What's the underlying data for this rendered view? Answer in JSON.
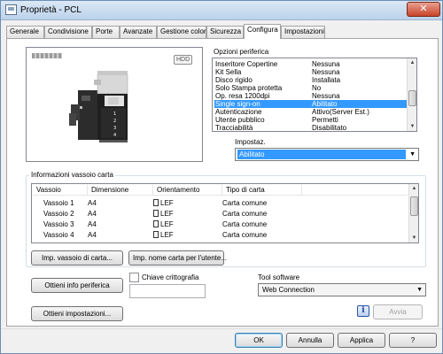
{
  "window": {
    "title": "Proprietà - PCL",
    "close_glyph": "✕"
  },
  "tabs": [
    {
      "label": "Generale"
    },
    {
      "label": "Condivisione"
    },
    {
      "label": "Porte"
    },
    {
      "label": "Avanzate"
    },
    {
      "label": "Gestione colori"
    },
    {
      "label": "Sicurezza"
    },
    {
      "label": "Configura",
      "active": true
    },
    {
      "label": "Impostazioni"
    }
  ],
  "preview": {
    "hdd_label": "HDD"
  },
  "options": {
    "label": "Opzioni periferica",
    "rows": [
      {
        "name": "Inseritore Copertine",
        "value": "Nessuna"
      },
      {
        "name": "Kit Sella",
        "value": "Nessuna"
      },
      {
        "name": "Disco rigido",
        "value": "Installata"
      },
      {
        "name": "Solo Stampa protetta",
        "value": "No"
      },
      {
        "name": "Op. resa 1200dpi",
        "value": "Nessuna"
      },
      {
        "name": "Single sign-on",
        "value": "Abilitato",
        "selected": true
      },
      {
        "name": "Autenticazione",
        "value": "Attivo(Server Est.)"
      },
      {
        "name": "Utente pubblico",
        "value": "Permetti"
      },
      {
        "name": "Tracciabilità",
        "value": "Disabilitato"
      }
    ]
  },
  "setting": {
    "label": "Impostaz.",
    "value": "Abilitato"
  },
  "tray_info": {
    "label": "Informazioni vassoio carta",
    "columns": [
      "Vassoio",
      "Dimensione",
      "Orientamento",
      "Tipo di carta"
    ],
    "rows": [
      {
        "tray": "Vassoio 1",
        "size": "A4",
        "orientation": "LEF",
        "type": "Carta comune"
      },
      {
        "tray": "Vassoio 2",
        "size": "A4",
        "orientation": "LEF",
        "type": "Carta comune"
      },
      {
        "tray": "Vassoio 3",
        "size": "A4",
        "orientation": "LEF",
        "type": "Carta comune"
      },
      {
        "tray": "Vassoio 4",
        "size": "A4",
        "orientation": "LEF",
        "type": "Carta comune"
      }
    ],
    "btn_tray_settings": "Imp. vassoio di carta...",
    "btn_paper_names": "Imp. nome carta per l'utente..."
  },
  "device": {
    "btn_get_info": "Ottieni info periferica",
    "encryption_label": "Chiave crittografia",
    "encryption_checked": false,
    "btn_get_settings": "Ottieni impostazioni...",
    "tool_label": "Tool software",
    "tool_value": "Web Connection",
    "btn_run": "Avvia"
  },
  "footer": {
    "ok": "OK",
    "cancel": "Annulla",
    "apply": "Applica",
    "help": "?"
  },
  "colors": {
    "selection": "#3399ff",
    "titlebar": "#bcd2ea",
    "close": "#c7442a"
  },
  "icons": [
    "printer-icon",
    "hdd-icon",
    "doc-icon",
    "info-icon",
    "chevron-down-icon"
  ]
}
